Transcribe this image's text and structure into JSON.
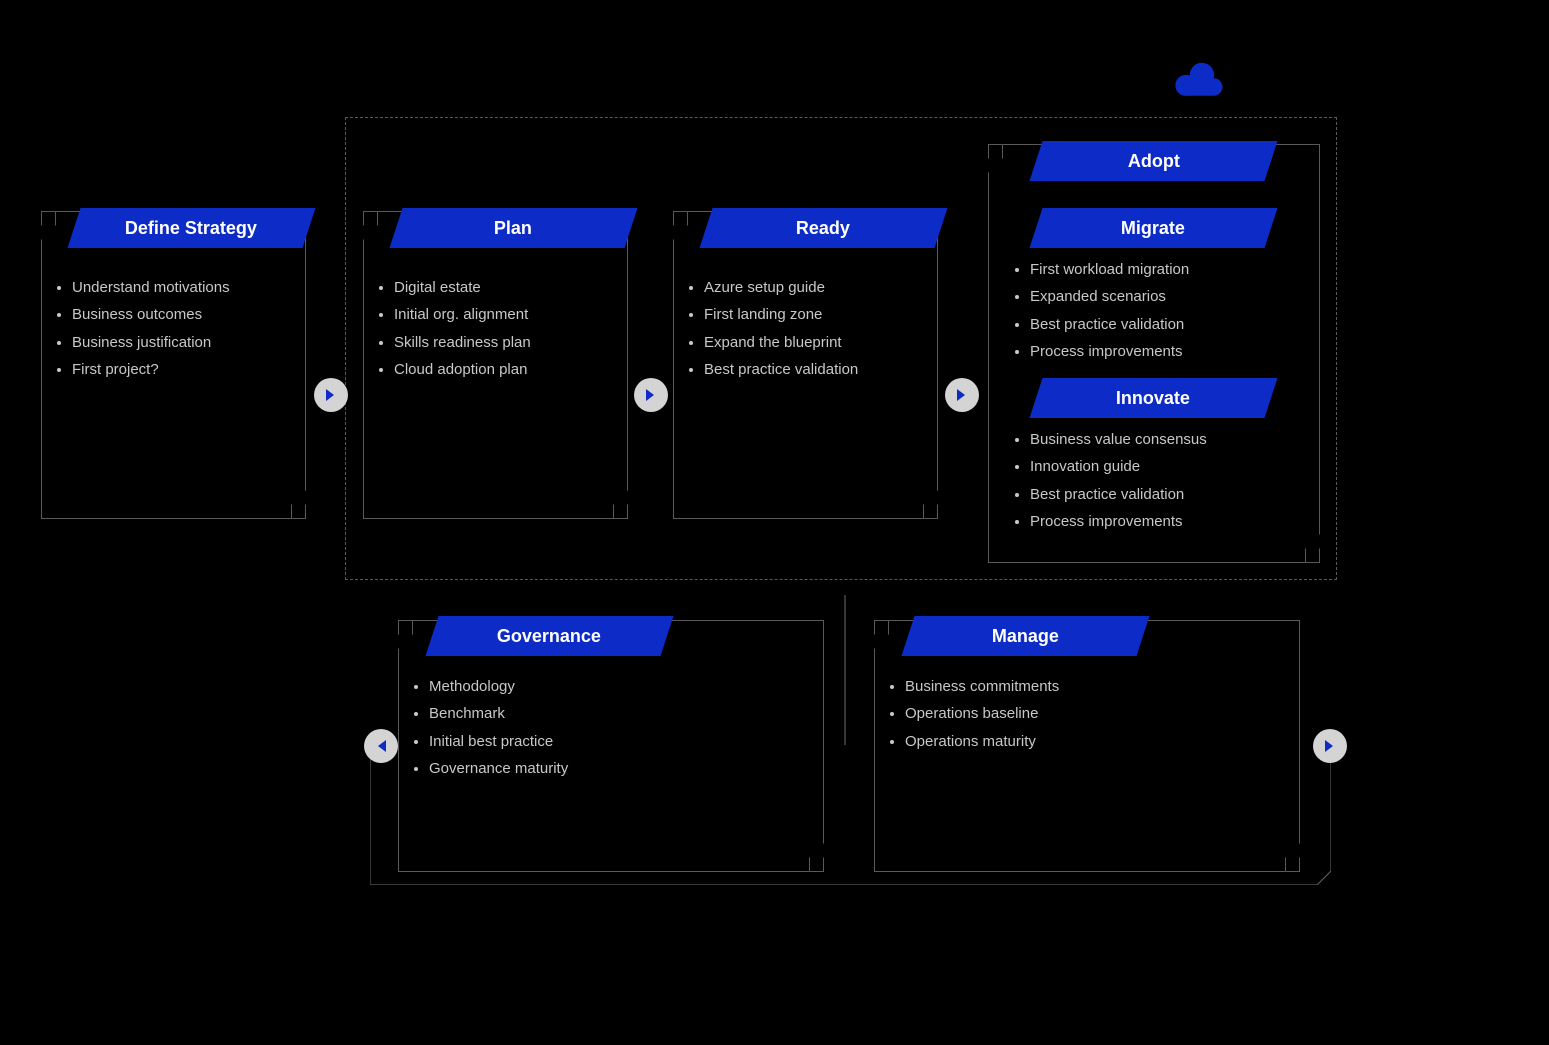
{
  "colors": {
    "accent": "#0c2bc7",
    "badge": "#d4d4d4"
  },
  "strategy": {
    "title": "Define Strategy",
    "items": [
      "Understand motivations",
      "Business outcomes",
      "Business justification",
      "First project?"
    ]
  },
  "plan": {
    "title": "Plan",
    "items": [
      "Digital estate",
      "Initial org. alignment",
      "Skills readiness plan",
      "Cloud adoption plan"
    ]
  },
  "ready": {
    "title": "Ready",
    "items": [
      "Azure setup guide",
      "First landing zone",
      "Expand the blueprint",
      "Best practice validation"
    ]
  },
  "adopt": {
    "title": "Adopt",
    "migrate": {
      "title": "Migrate",
      "items": [
        "First workload migration",
        "Expanded scenarios",
        "Best practice validation",
        "Process improvements"
      ]
    },
    "innovate": {
      "title": "Innovate",
      "items": [
        "Business value consensus",
        "Innovation guide",
        "Best practice validation",
        "Process improvements"
      ]
    }
  },
  "governance": {
    "title": "Governance",
    "items": [
      "Methodology",
      "Benchmark",
      "Initial best practice",
      "Governance maturity"
    ]
  },
  "manage": {
    "title": "Manage",
    "items": [
      "Business commitments",
      "Operations baseline",
      "Operations maturity"
    ]
  }
}
